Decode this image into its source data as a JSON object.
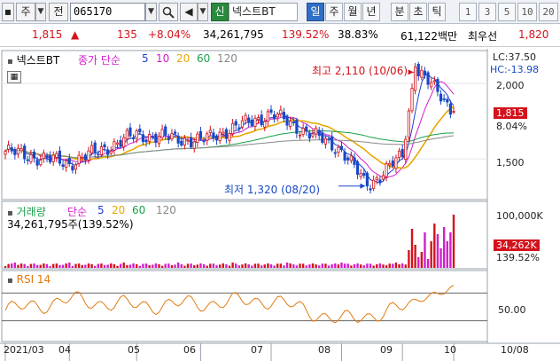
{
  "toolbar": {
    "side_label": "주",
    "jeon_label": "전",
    "code_value": "065170",
    "search_icon": "magnifier-icon",
    "credit_label": "신",
    "stock_name": "넥스트BT",
    "period_tabs": [
      "일",
      "주",
      "월",
      "년",
      "분",
      "초",
      "틱"
    ],
    "active_period": "일",
    "number_tabs": [
      "1",
      "3",
      "5",
      "10",
      "20"
    ]
  },
  "quote": {
    "price": "1,815",
    "price_arrow": "▲",
    "change": "135",
    "change_pct": "+8.04%",
    "volume": "34,261,795",
    "volume_ratio": "139.52%",
    "turnover": "38.83%",
    "amount": "61,122백만",
    "best_label": "최우선",
    "best_price": "1,820"
  },
  "chart_header": {
    "name": "넥스트BT",
    "price_legend": "종가 단순",
    "ma_periods": [
      "5",
      "10",
      "20",
      "60",
      "120"
    ],
    "lc": "LC:37.50",
    "hc": "HC:-13.98",
    "high_annotation": "최고 2,110 (10/06)",
    "low_annotation": "최저 1,320 (08/20)"
  },
  "price_axis": {
    "ticks": [
      "2,000",
      "1,500"
    ],
    "current_price": "1,815",
    "current_pct": "8.04%"
  },
  "volume_panel": {
    "title": "거래량",
    "legend": "단순",
    "ma_periods": [
      "5",
      "20",
      "60",
      "120"
    ],
    "readout": "34,261,795주(139.52%)",
    "axis_tick": "100,000K",
    "current_tag": "34,262K",
    "current_pct": "139.52%"
  },
  "rsi_panel": {
    "title": "RSI 14",
    "axis_tick": "50.00"
  },
  "x_axis": {
    "labels": [
      "2021/03",
      "04",
      "05",
      "06",
      "07",
      "08",
      "09",
      "10"
    ],
    "cursor_date": "10/08"
  },
  "colors": {
    "up": "#d4121b",
    "down": "#1849c6",
    "ma5": "#1f3fd6",
    "ma10": "#d41dcc",
    "ma20": "#e8a800",
    "ma60": "#1aa04a",
    "ma120": "#888888",
    "rsi": "#e07a10"
  },
  "chart_data": {
    "type": "line",
    "x": [
      "2021/03",
      "04",
      "05",
      "06",
      "07",
      "08",
      "09",
      "10"
    ],
    "series": [
      {
        "name": "종가",
        "values": [
          1550,
          1470,
          1660,
          1620,
          1800,
          1560,
          1520,
          1815
        ]
      },
      {
        "name": "RSI 14",
        "values": [
          45,
          60,
          52,
          55,
          60,
          30,
          48,
          75
        ]
      }
    ],
    "annotations": [
      {
        "text": "최고 2,110 (10/06)",
        "value": 2110,
        "date": "10/06"
      },
      {
        "text": "최저 1,320 (08/20)",
        "value": 1320,
        "date": "08/20"
      }
    ]
  }
}
